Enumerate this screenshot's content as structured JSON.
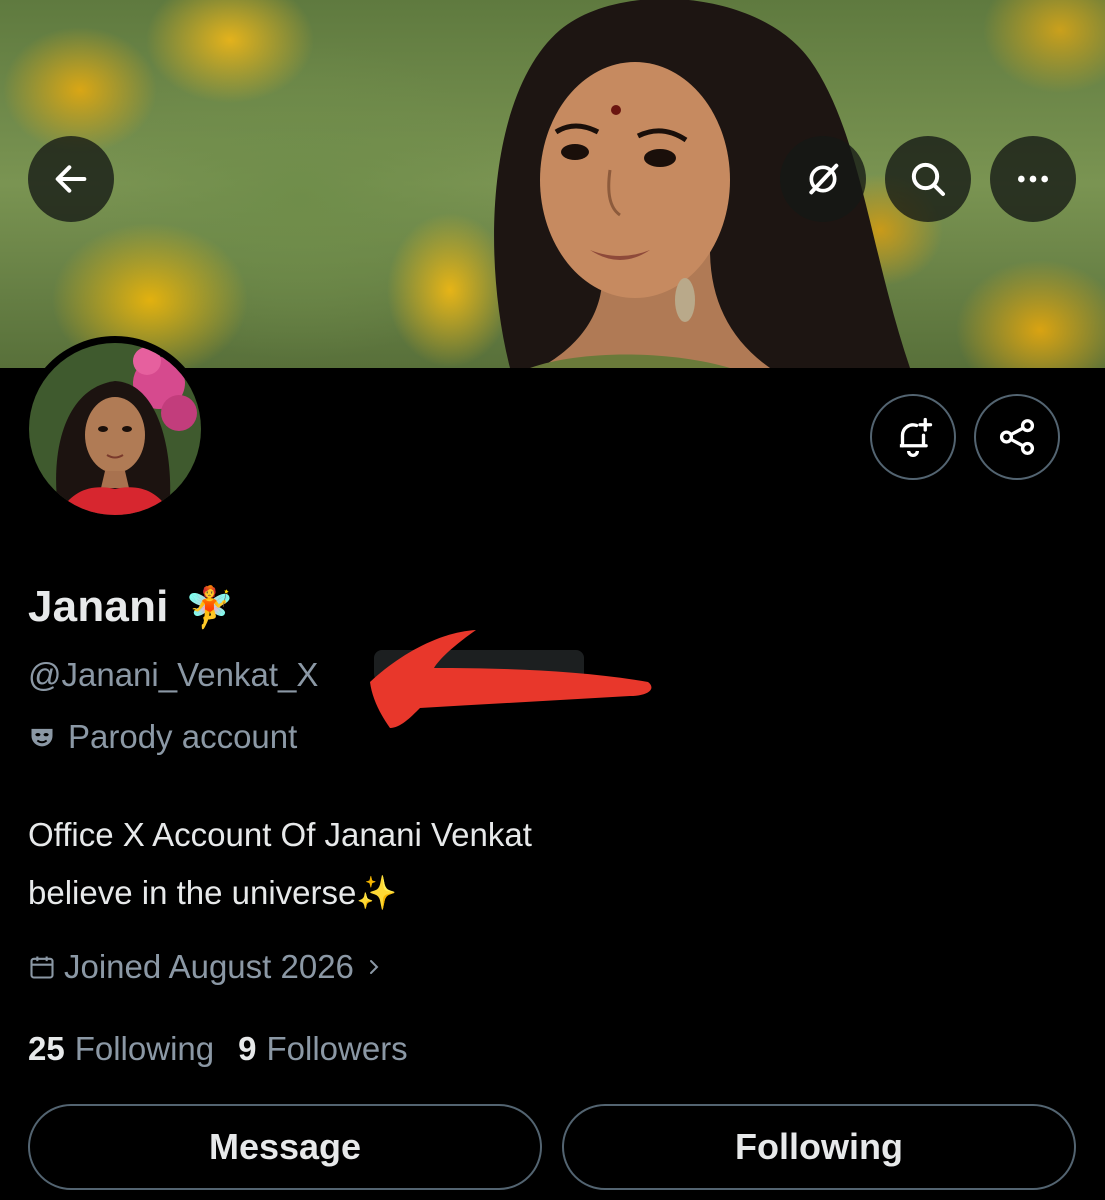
{
  "profile": {
    "name": "Janani",
    "name_emoji": "🧚",
    "handle": "@Janani_Venkat_X",
    "label": "Parody account",
    "bio_line1": "Office X Account Of Janani Venkat",
    "bio_line2": "believe in the universe✨",
    "joined": "Joined August 2026",
    "following_count": "25",
    "following_label": "Following",
    "followers_count": "9",
    "followers_label": "Followers"
  },
  "actions": {
    "message_label": "Message",
    "following_label": "Following"
  },
  "icons": {
    "back": "arrow-left-icon",
    "grok": "grok-icon",
    "search": "search-icon",
    "more": "more-horizontal-icon",
    "notify": "bell-plus-icon",
    "share": "share-icon",
    "parody": "mask-icon",
    "calendar": "calendar-icon",
    "chevron": "chevron-right-icon"
  },
  "colors": {
    "background": "#000000",
    "text_primary": "#e7e9ea",
    "text_secondary": "#8b98a5",
    "border": "#536471",
    "redaction": "#e8372b"
  }
}
